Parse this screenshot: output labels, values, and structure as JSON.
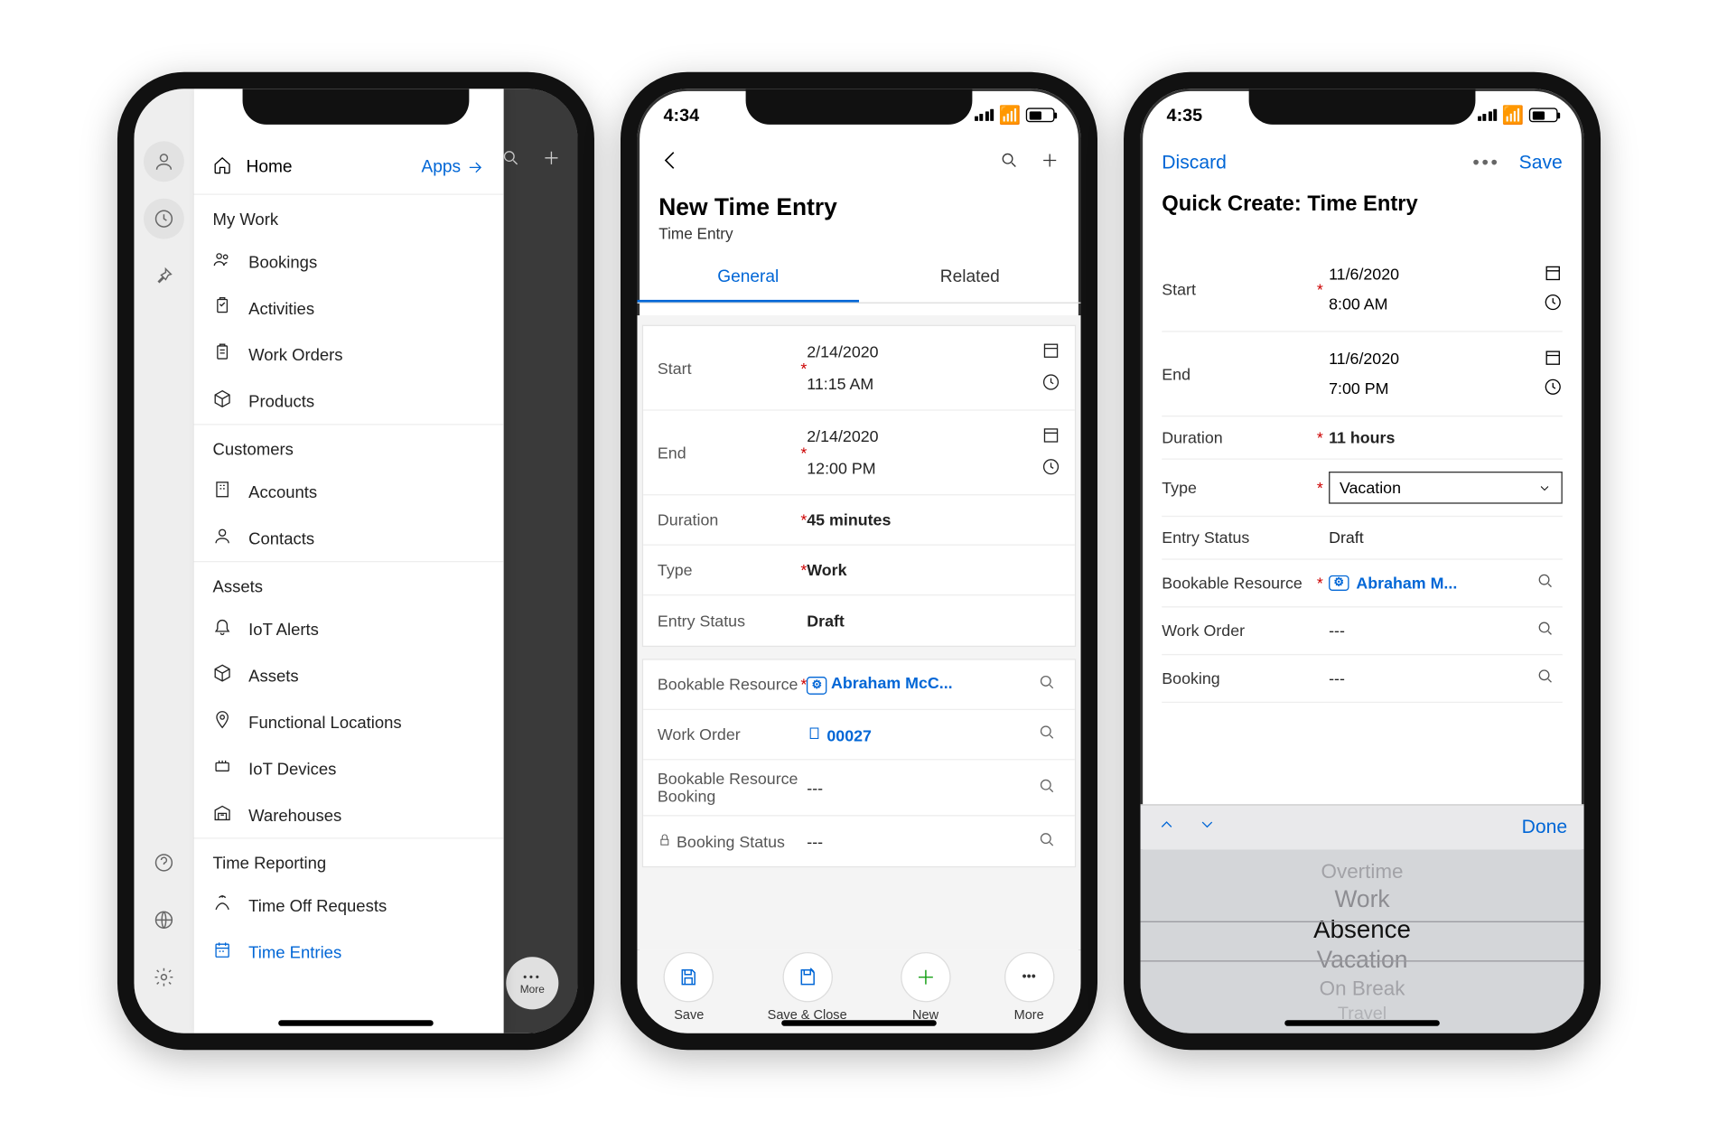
{
  "phone1": {
    "home": "Home",
    "apps": "Apps",
    "sections": [
      {
        "title": "My Work",
        "items": [
          "Bookings",
          "Activities",
          "Work Orders",
          "Products"
        ]
      },
      {
        "title": "Customers",
        "items": [
          "Accounts",
          "Contacts"
        ]
      },
      {
        "title": "Assets",
        "items": [
          "IoT Alerts",
          "Assets",
          "Functional Locations",
          "IoT Devices",
          "Warehouses"
        ]
      },
      {
        "title": "Time Reporting",
        "items": [
          "Time Off Requests",
          "Time Entries"
        ]
      }
    ],
    "more": "More"
  },
  "phone2": {
    "time": "4:34",
    "title": "New Time Entry",
    "subtitle": "Time Entry",
    "tabs": [
      "General",
      "Related"
    ],
    "fields": {
      "start_label": "Start",
      "start_date": "2/14/2020",
      "start_time": "11:15 AM",
      "end_label": "End",
      "end_date": "2/14/2020",
      "end_time": "12:00 PM",
      "duration_label": "Duration",
      "duration": "45 minutes",
      "type_label": "Type",
      "type": "Work",
      "status_label": "Entry Status",
      "status": "Draft",
      "res_label": "Bookable Resource",
      "res": "Abraham McC...",
      "wo_label": "Work Order",
      "wo": "00027",
      "brb_label": "Bookable Resource Booking",
      "brb": "---",
      "bs_label": "Booking Status",
      "bs": "---"
    },
    "toolbar": {
      "save": "Save",
      "saveclose": "Save & Close",
      "new": "New",
      "more": "More"
    }
  },
  "phone3": {
    "time": "4:35",
    "discard": "Discard",
    "save": "Save",
    "title": "Quick Create: Time Entry",
    "fields": {
      "start_label": "Start",
      "start_date": "11/6/2020",
      "start_time": "8:00 AM",
      "end_label": "End",
      "end_date": "11/6/2020",
      "end_time": "7:00 PM",
      "duration_label": "Duration",
      "duration": "11 hours",
      "type_label": "Type",
      "type": "Vacation",
      "status_label": "Entry Status",
      "status": "Draft",
      "res_label": "Bookable Resource",
      "res": "Abraham M...",
      "wo_label": "Work Order",
      "wo": "---",
      "bk_label": "Booking",
      "bk": "---"
    },
    "done": "Done",
    "picker": [
      "Overtime",
      "Work",
      "Absence",
      "Vacation",
      "On Break",
      "Travel"
    ]
  }
}
